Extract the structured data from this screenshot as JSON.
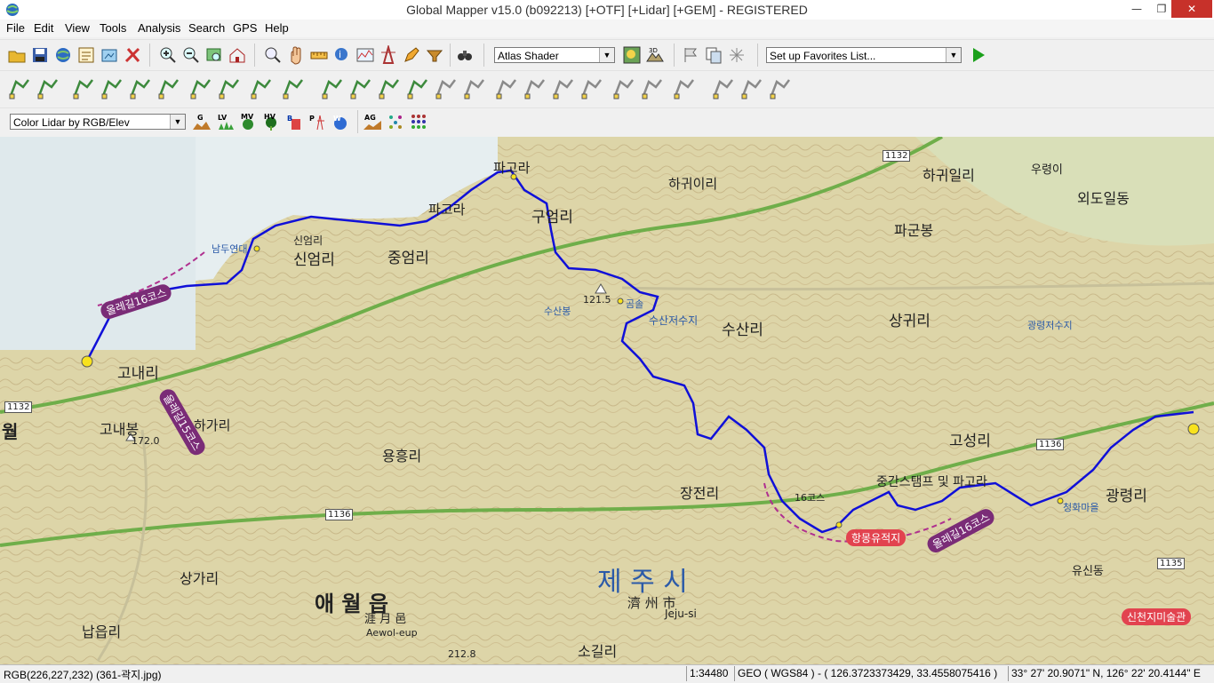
{
  "window": {
    "title": "Global Mapper v15.0 (b092213) [+OTF] [+Lidar] [+GEM] - REGISTERED",
    "min_glyph": "—",
    "max_glyph": "❐",
    "close_glyph": "✕"
  },
  "menu": [
    "File",
    "Edit",
    "View",
    "Tools",
    "Analysis",
    "Search",
    "GPS",
    "Help"
  ],
  "toolbar": {
    "shader_value": "Atlas Shader",
    "favorites_value": "Set up Favorites List...",
    "lidar_color_value": "Color Lidar by RGB/Elev",
    "lidar_buttons": [
      "G",
      "LV",
      "MV",
      "HV",
      "B",
      "P",
      "W",
      "AG"
    ]
  },
  "map": {
    "labels": [
      {
        "text": "파고라",
        "size": 15
      },
      {
        "text": "파고라",
        "size": 15
      },
      {
        "text": "신엄리",
        "size": 17
      },
      {
        "text": "중엄리",
        "size": 17
      },
      {
        "text": "구엄리",
        "size": 17
      },
      {
        "text": "하귀이리",
        "size": 15
      },
      {
        "text": "하귀일리",
        "size": 16
      },
      {
        "text": "외도일동",
        "size": 16
      },
      {
        "text": "우령이",
        "size": 13
      },
      {
        "text": "파군봉",
        "size": 16
      },
      {
        "text": "고내리",
        "size": 17
      },
      {
        "text": "고내봉",
        "size": 16
      },
      {
        "text": "하가리",
        "size": 15
      },
      {
        "text": "수산리",
        "size": 17
      },
      {
        "text": "상귀리",
        "size": 17
      },
      {
        "text": "고성리",
        "size": 17
      },
      {
        "text": "광령리",
        "size": 17
      },
      {
        "text": "장전리",
        "size": 16
      },
      {
        "text": "용흥리",
        "size": 16
      },
      {
        "text": "상가리",
        "size": 16
      },
      {
        "text": "납읍리",
        "size": 16
      },
      {
        "text": "애 월 읍",
        "size": 24
      },
      {
        "text": "제 주 시",
        "size": 30
      },
      {
        "text": "濟 州 市",
        "size": 15
      },
      {
        "text": "Jeju-si",
        "size": 12
      },
      {
        "text": "涯 月 邑",
        "size": 13
      },
      {
        "text": "Aewol-eup",
        "size": 11
      },
      {
        "text": "소길리",
        "size": 16
      },
      {
        "text": "유신동",
        "size": 13
      },
      {
        "text": "중간스탬프 및 파고라",
        "size": 14
      },
      {
        "text": "항몽유적지",
        "size": 12
      },
      {
        "text": "신천지미술관",
        "size": 12
      },
      {
        "text": "올레길16코스",
        "size": 12
      },
      {
        "text": "올레길16코스",
        "size": 12
      },
      {
        "text": "올레길15코스",
        "size": 12
      },
      {
        "text": "121.5",
        "size": 11
      },
      {
        "text": "172.0",
        "size": 11
      },
      {
        "text": "212.8",
        "size": 11
      },
      {
        "text": "1132",
        "size": 10
      },
      {
        "text": "1132",
        "size": 10
      },
      {
        "text": "1136",
        "size": 10
      },
      {
        "text": "1136",
        "size": 10
      },
      {
        "text": "1135",
        "size": 10
      },
      {
        "text": "16코스",
        "size": 11
      },
      {
        "text": "월",
        "size": 20
      },
      {
        "text": "신엄리",
        "size": 12
      },
      {
        "text": "남두연대",
        "size": 11
      },
      {
        "text": "수산봉",
        "size": 11
      },
      {
        "text": "곰솔",
        "size": 11
      },
      {
        "text": "수산저수지",
        "size": 12
      },
      {
        "text": "광령저수지",
        "size": 11
      },
      {
        "text": "청화마을",
        "size": 11
      }
    ]
  },
  "status": {
    "pixel": "RGB(226,227,232) (361-곽지.jpg)",
    "scale": "1:34480",
    "coords": "GEO ( WGS84 ) - ( 126.3723373429, 33.4558075416 )",
    "dms": "33° 27' 20.9071\" N, 126° 22' 20.4144\" E"
  }
}
